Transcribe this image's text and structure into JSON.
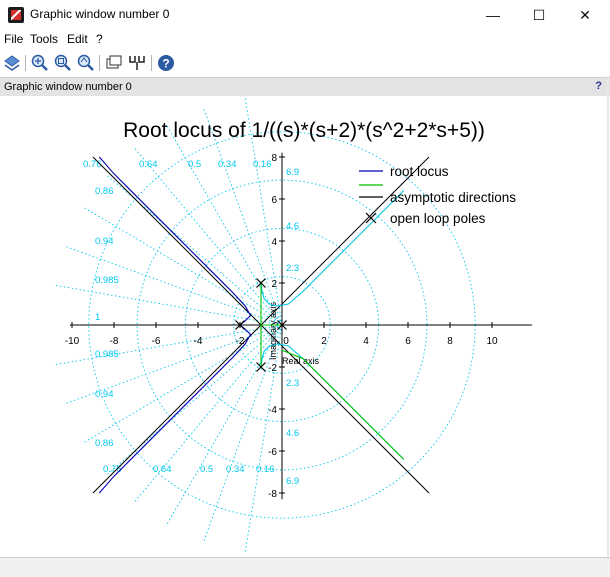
{
  "window": {
    "title": "Graphic window number 0",
    "info_text": "Graphic window number 0",
    "help_glyph": "?",
    "controls": {
      "minimize": "—",
      "maximize": "☐",
      "close": "✕"
    }
  },
  "menubar": {
    "items": [
      "File",
      "Tools",
      "Edit",
      "?"
    ]
  },
  "toolbar": {
    "icons": [
      "rotate-icon",
      "zoom-in-icon",
      "zoom-region-icon",
      "zoom-fit-icon",
      "datatip-icon",
      "graph-editor-icon",
      "help-icon"
    ]
  },
  "chart_data": {
    "type": "line",
    "title": "Root locus of 1/((s)*(s+2)*(s^2+2*s+5))",
    "xlabel": "Real axis",
    "ylabel": "Imaginary axis",
    "xlim": [
      -10,
      10
    ],
    "ylim": [
      -8,
      8
    ],
    "xticks": [
      "-10",
      "-8",
      "-6",
      "-4",
      "-2",
      "0",
      "2",
      "4",
      "6",
      "8",
      "10"
    ],
    "yticks": [
      "-8",
      "-6",
      "-4",
      "-2",
      "0",
      "2",
      "4",
      "6",
      "8"
    ],
    "grid": {
      "damping_labels": [
        "0.76",
        "0.64",
        "0.5",
        "0.34",
        "0.16",
        "0.86",
        "0.94",
        "0.985",
        "1"
      ],
      "wn_labels": [
        "2.3",
        "4.6",
        "6.9"
      ],
      "color": "#00c8f0"
    },
    "legend": {
      "placement": "top-right",
      "entries": [
        "root locus",
        "",
        "asymptotic directions",
        "open loop poles"
      ]
    },
    "colors": {
      "root_locus": "#0000b4",
      "root_locus_alt": "#00c8e6",
      "segment": "#00c000",
      "asymptote": "#000000",
      "pole": "#000000"
    },
    "poles": [
      [
        0,
        0
      ],
      [
        -2,
        0
      ],
      [
        -1,
        2
      ],
      [
        -1,
        -2
      ]
    ],
    "series": [
      {
        "name": "root locus",
        "points": [
          [
            -1,
            2
          ],
          [
            -0.95,
            1.6
          ],
          [
            -0.85,
            1.25
          ],
          [
            -0.6,
            1.0
          ],
          [
            -0.2,
            0.9
          ],
          [
            0.3,
            1.0
          ],
          [
            1.0,
            1.6
          ],
          [
            2,
            2.6
          ],
          [
            3,
            3.6
          ],
          [
            4,
            4.6
          ],
          [
            5,
            5.6
          ],
          [
            5.8,
            6.4
          ]
        ]
      },
      {
        "name": "root locus",
        "points": [
          [
            -1,
            -2
          ],
          [
            -0.95,
            -1.6
          ],
          [
            -0.85,
            -1.25
          ],
          [
            -0.6,
            -1.0
          ],
          [
            -0.2,
            -0.9
          ],
          [
            0.3,
            -1.0
          ],
          [
            1.0,
            -1.6
          ],
          [
            2,
            -2.6
          ],
          [
            3,
            -3.6
          ],
          [
            4,
            -4.6
          ],
          [
            5,
            -5.6
          ],
          [
            5.8,
            -6.4
          ]
        ]
      },
      {
        "name": "root locus",
        "points": [
          [
            -2,
            0
          ],
          [
            -1.75,
            0.2
          ],
          [
            -1.5,
            0.45
          ],
          [
            -1.75,
            0.9
          ],
          [
            -2.3,
            1.5
          ],
          [
            -3,
            2.2
          ],
          [
            -4,
            3.2
          ],
          [
            -5,
            4.2
          ],
          [
            -6,
            5.2
          ],
          [
            -7,
            6.2
          ],
          [
            -8,
            7.2
          ],
          [
            -8.7,
            8
          ]
        ]
      },
      {
        "name": "root locus",
        "points": [
          [
            -2,
            0
          ],
          [
            -1.75,
            -0.2
          ],
          [
            -1.5,
            -0.45
          ],
          [
            -1.75,
            -0.9
          ],
          [
            -2.3,
            -1.5
          ],
          [
            -3,
            -2.2
          ],
          [
            -4,
            -3.2
          ],
          [
            -5,
            -4.2
          ],
          [
            -6,
            -5.2
          ],
          [
            -7,
            -6.2
          ],
          [
            -8,
            -7.2
          ],
          [
            -8.7,
            -8
          ]
        ]
      },
      {
        "name": "",
        "points": [
          [
            -1,
            0
          ],
          [
            -1,
            2
          ]
        ]
      },
      {
        "name": "",
        "points": [
          [
            -1,
            0
          ],
          [
            -1,
            -2
          ]
        ]
      },
      {
        "name": "",
        "points": [
          [
            0,
            0
          ],
          [
            -1,
            0
          ]
        ]
      },
      {
        "name": "",
        "points": [
          [
            0,
            -1.2
          ],
          [
            1,
            -1.6
          ],
          [
            2,
            -2.6
          ],
          [
            3,
            -3.6
          ],
          [
            4,
            -4.6
          ],
          [
            5,
            -5.6
          ],
          [
            5.8,
            -6.4
          ]
        ]
      }
    ],
    "asymptotes": [
      {
        "name": "asymptotic directions",
        "points": [
          [
            -1,
            0
          ],
          [
            7,
            8
          ]
        ]
      },
      {
        "name": "asymptotic directions",
        "points": [
          [
            -1,
            0
          ],
          [
            7,
            -8
          ]
        ]
      },
      {
        "name": "asymptotic directions",
        "points": [
          [
            -1,
            0
          ],
          [
            -9,
            8
          ]
        ]
      },
      {
        "name": "asymptotic directions",
        "points": [
          [
            -1,
            0
          ],
          [
            -9,
            -8
          ]
        ]
      }
    ]
  }
}
